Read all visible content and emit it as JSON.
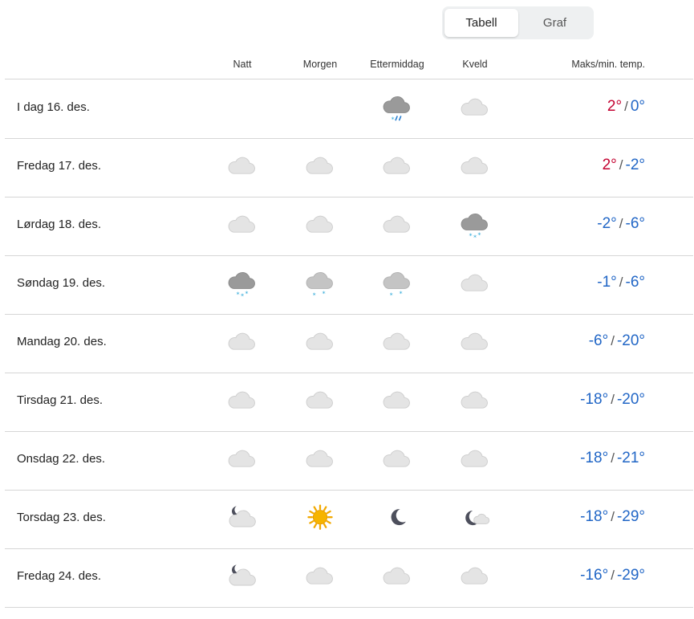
{
  "toggle": {
    "options": [
      "Tabell",
      "Graf"
    ],
    "selected": "Tabell"
  },
  "header": {
    "night": "Natt",
    "morning": "Morgen",
    "afternoon": "Ettermiddag",
    "evening": "Kveld",
    "temp": "Maks/min. temp."
  },
  "colors": {
    "warm": "#c3002f",
    "cold": "#2166c6"
  },
  "rows": [
    {
      "date": "I dag 16. des.",
      "icons": [
        "",
        "",
        "cloud-sleet",
        "cloud"
      ],
      "max": "2°",
      "min": "0°",
      "max_warm": true,
      "min_warm": false
    },
    {
      "date": "Fredag 17. des.",
      "icons": [
        "cloud",
        "cloud",
        "cloud",
        "cloud"
      ],
      "max": "2°",
      "min": "-2°",
      "max_warm": true,
      "min_warm": false
    },
    {
      "date": "Lørdag 18. des.",
      "icons": [
        "cloud",
        "cloud",
        "cloud",
        "cloud-snow"
      ],
      "max": "-2°",
      "min": "-6°",
      "max_warm": false,
      "min_warm": false
    },
    {
      "date": "Søndag 19. des.",
      "icons": [
        "cloud-snow",
        "cloud-light-snow",
        "cloud-light-snow",
        "cloud"
      ],
      "max": "-1°",
      "min": "-6°",
      "max_warm": false,
      "min_warm": false
    },
    {
      "date": "Mandag 20. des.",
      "icons": [
        "cloud",
        "cloud",
        "cloud",
        "cloud"
      ],
      "max": "-6°",
      "min": "-20°",
      "max_warm": false,
      "min_warm": false
    },
    {
      "date": "Tirsdag 21. des.",
      "icons": [
        "cloud",
        "cloud",
        "cloud",
        "cloud"
      ],
      "max": "-18°",
      "min": "-20°",
      "max_warm": false,
      "min_warm": false
    },
    {
      "date": "Onsdag 22. des.",
      "icons": [
        "cloud",
        "cloud",
        "cloud",
        "cloud"
      ],
      "max": "-18°",
      "min": "-21°",
      "max_warm": false,
      "min_warm": false
    },
    {
      "date": "Torsdag 23. des.",
      "icons": [
        "moon-cloud",
        "sun",
        "moon",
        "moon-small-cloud"
      ],
      "max": "-18°",
      "min": "-29°",
      "max_warm": false,
      "min_warm": false
    },
    {
      "date": "Fredag 24. des.",
      "icons": [
        "moon-cloud",
        "cloud",
        "cloud",
        "cloud"
      ],
      "max": "-16°",
      "min": "-29°",
      "max_warm": false,
      "min_warm": false
    }
  ]
}
